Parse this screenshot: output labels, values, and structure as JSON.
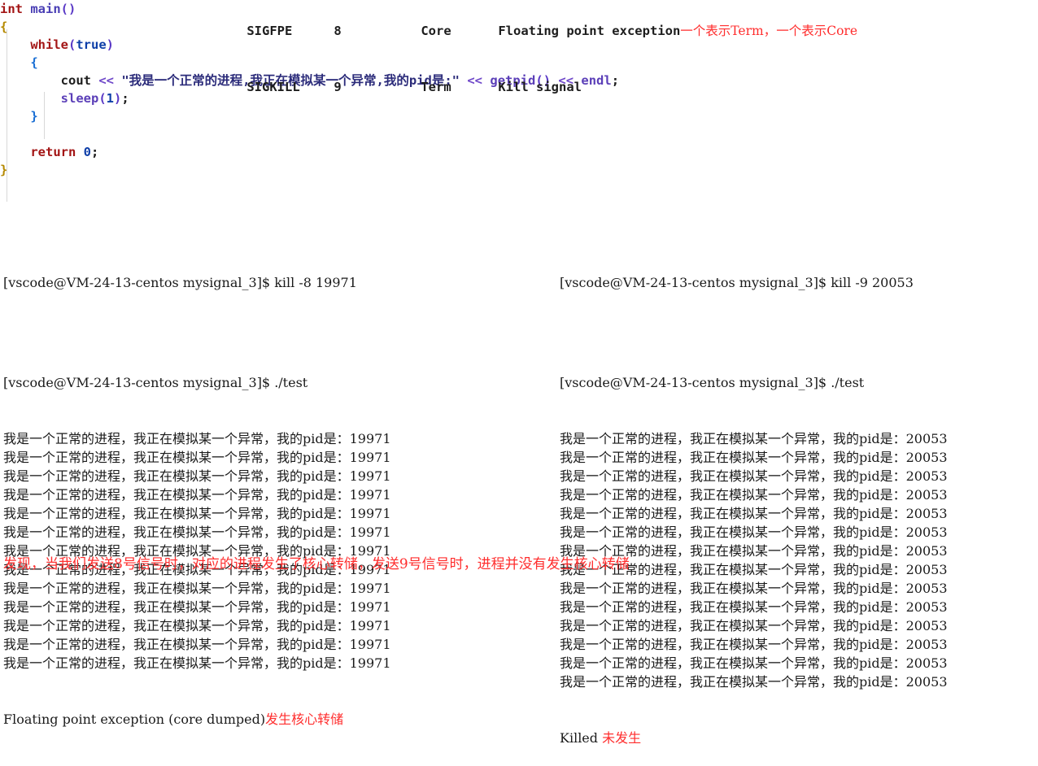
{
  "code": {
    "lines": [
      [
        {
          "t": "int ",
          "c": "tok-type"
        },
        {
          "t": "main",
          "c": "tok-fn"
        },
        {
          "t": "()",
          "c": "tok-brace-p"
        }
      ],
      [
        {
          "t": "{",
          "c": "tok-brace-y"
        }
      ],
      [
        {
          "t": "    ",
          "c": "tok-plain"
        },
        {
          "t": "while",
          "c": "tok-kw"
        },
        {
          "t": "(",
          "c": "tok-brace-p"
        },
        {
          "t": "true",
          "c": "tok-kwb"
        },
        {
          "t": ")",
          "c": "tok-brace-p"
        }
      ],
      [
        {
          "t": "    ",
          "c": "tok-plain"
        },
        {
          "t": "{",
          "c": "tok-brace-b"
        }
      ],
      [
        {
          "t": "        ",
          "c": "tok-plain"
        },
        {
          "t": "cout",
          "c": "tok-plain"
        },
        {
          "t": " ",
          "c": "tok-plain"
        },
        {
          "t": "<<",
          "c": "tok-op"
        },
        {
          "t": " ",
          "c": "tok-plain"
        },
        {
          "t": "\"我是一个正常的进程,我正在模拟某一个异常,我的pid是:\"",
          "c": "tok-str"
        },
        {
          "t": " ",
          "c": "tok-plain"
        },
        {
          "t": "<<",
          "c": "tok-op"
        },
        {
          "t": " ",
          "c": "tok-plain"
        },
        {
          "t": "getpid",
          "c": "tok-id"
        },
        {
          "t": "()",
          "c": "tok-brace-p"
        },
        {
          "t": " ",
          "c": "tok-plain"
        },
        {
          "t": "<<",
          "c": "tok-op"
        },
        {
          "t": " ",
          "c": "tok-plain"
        },
        {
          "t": "endl",
          "c": "tok-id"
        },
        {
          "t": ";",
          "c": "tok-punct"
        }
      ],
      [
        {
          "t": "        ",
          "c": "tok-plain"
        },
        {
          "t": "sleep",
          "c": "tok-id"
        },
        {
          "t": "(",
          "c": "tok-brace-p"
        },
        {
          "t": "1",
          "c": "tok-num"
        },
        {
          "t": ")",
          "c": "tok-brace-p"
        },
        {
          "t": ";",
          "c": "tok-punct"
        }
      ],
      [
        {
          "t": "    ",
          "c": "tok-plain"
        },
        {
          "t": "}",
          "c": "tok-brace-b"
        }
      ],
      [
        {
          "t": "",
          "c": "tok-plain"
        }
      ],
      [
        {
          "t": "    ",
          "c": "tok-plain"
        },
        {
          "t": "return",
          "c": "tok-kw"
        },
        {
          "t": " ",
          "c": "tok-plain"
        },
        {
          "t": "0",
          "c": "tok-num"
        },
        {
          "t": ";",
          "c": "tok-punct"
        }
      ],
      [
        {
          "t": "}",
          "c": "tok-brace-y"
        }
      ]
    ]
  },
  "signal_table": {
    "rows": [
      {
        "name": "SIGFPE",
        "number": "8",
        "action": "Core",
        "description": "Floating point exception"
      },
      {
        "name": "SIGKILL",
        "number": "9",
        "action": "Term",
        "description": "Kill signal"
      }
    ],
    "annotation": "一个表示Term，一个表示Core"
  },
  "terminal_left": {
    "prompt_kill": "[vscode@VM-24-13-centos mysignal_3]$ kill -8 19971",
    "prompt_run": "[vscode@VM-24-13-centos mysignal_3]$ ./test",
    "output_line": "我是一个正常的进程，我正在模拟某一个异常，我的pid是：19971",
    "output_count": 13,
    "exit_line": "Floating point exception (core dumped)",
    "exit_annotation": "发生核心转储"
  },
  "terminal_right": {
    "prompt_kill": "[vscode@VM-24-13-centos mysignal_3]$ kill -9 20053",
    "prompt_run": "[vscode@VM-24-13-centos mysignal_3]$ ./test",
    "output_line": "我是一个正常的进程，我正在模拟某一个异常，我的pid是：20053",
    "output_count": 14,
    "exit_line": "Killed",
    "exit_annotation": "未发生"
  },
  "summary": {
    "text": "发现，当我们发送8号信号时，对应的进程发生了核心转储，发送9号信号时，进程并没有发生核心转储"
  },
  "colors": {
    "annotation_red": "#ff2d2d",
    "code_type": "#a31515",
    "code_function": "#4a3fb5",
    "code_string": "#2b2b7a",
    "code_operator": "#6f48c9",
    "terminal_text": "#1a1a1a",
    "background": "#ffffff"
  }
}
